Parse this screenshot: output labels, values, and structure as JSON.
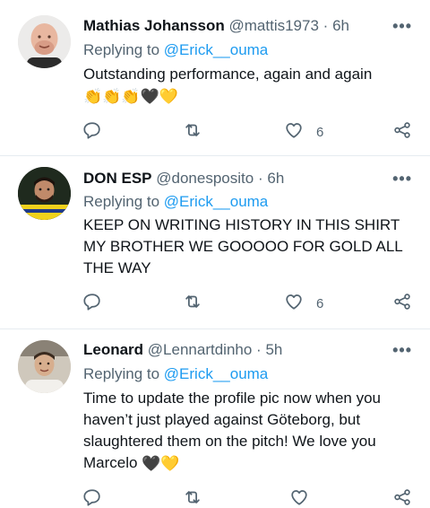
{
  "tweets": [
    {
      "name": "Mathias Johansson",
      "handle": "@mattis1973",
      "dot": "·",
      "time": "6h",
      "replying_prefix": "Replying to",
      "replying_to": "@Erick__ouma",
      "text": "Outstanding performance, again and again",
      "emoji_line": "👏👏👏🖤💛",
      "likes": "6"
    },
    {
      "name": "DON ESP",
      "handle": "@donesposito",
      "dot": "·",
      "time": "6h",
      "replying_prefix": "Replying to",
      "replying_to": "@Erick__ouma",
      "text": "KEEP ON WRITING HISTORY IN THIS SHIRT MY BROTHER WE GOOOOO FOR GOLD ALL THE WAY",
      "likes": "6"
    },
    {
      "name": "Leonard",
      "handle": "@Lennartdinho",
      "dot": "·",
      "time": "5h",
      "replying_prefix": "Replying to",
      "replying_to": "@Erick__ouma",
      "text": "Time to update the profile pic now when you haven’t just played against Göteborg, but slaughtered them on the pitch! We love you Marcelo",
      "emoji_line": "🖤💛",
      "likes": ""
    }
  ],
  "more_label": "•••",
  "icons": {
    "reply": "reply-icon",
    "retweet": "retweet-icon",
    "like": "heart-icon",
    "share": "share-icon"
  },
  "colors": {
    "accent": "#1d9bf0",
    "secondary_text": "#536471",
    "primary_text": "#0f1419",
    "divider": "#e6ecf0"
  }
}
